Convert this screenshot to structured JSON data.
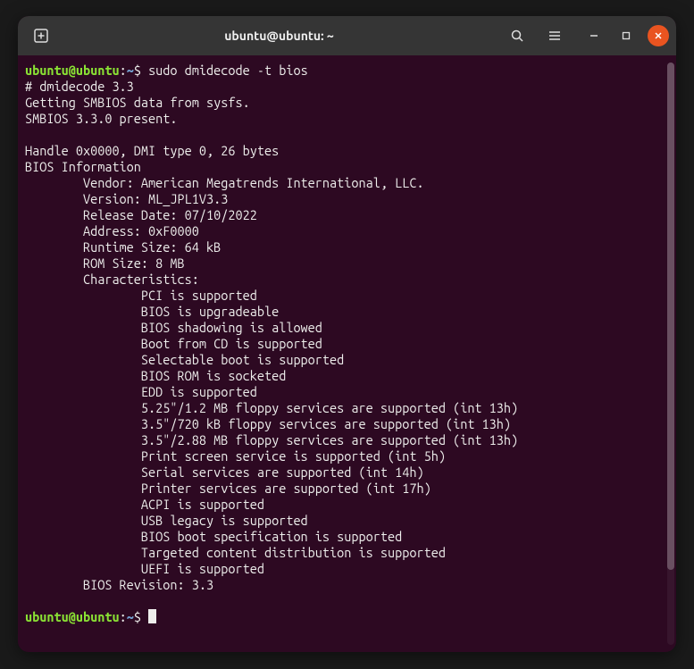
{
  "titlebar": {
    "title": "ubuntu@ubuntu: ~"
  },
  "prompt": {
    "user_host": "ubuntu@ubuntu",
    "path": "~",
    "symbol": "$"
  },
  "command": "sudo dmidecode -t bios",
  "output": {
    "header1": "# dmidecode 3.3",
    "header2": "Getting SMBIOS data from sysfs.",
    "header3": "SMBIOS 3.3.0 present.",
    "handle": "Handle 0x0000, DMI type 0, 26 bytes",
    "section": "BIOS Information",
    "fields": [
      "        Vendor: American Megatrends International, LLC.",
      "        Version: ML_JPL1V3.3",
      "        Release Date: 07/10/2022",
      "        Address: 0xF0000",
      "        Runtime Size: 64 kB",
      "        ROM Size: 8 MB",
      "        Characteristics:"
    ],
    "characteristics": [
      "                PCI is supported",
      "                BIOS is upgradeable",
      "                BIOS shadowing is allowed",
      "                Boot from CD is supported",
      "                Selectable boot is supported",
      "                BIOS ROM is socketed",
      "                EDD is supported",
      "                5.25\"/1.2 MB floppy services are supported (int 13h)",
      "                3.5\"/720 kB floppy services are supported (int 13h)",
      "                3.5\"/2.88 MB floppy services are supported (int 13h)",
      "                Print screen service is supported (int 5h)",
      "                Serial services are supported (int 14h)",
      "                Printer services are supported (int 17h)",
      "                ACPI is supported",
      "                USB legacy is supported",
      "                BIOS boot specification is supported",
      "                Targeted content distribution is supported",
      "                UEFI is supported"
    ],
    "revision": "        BIOS Revision: 3.3"
  }
}
